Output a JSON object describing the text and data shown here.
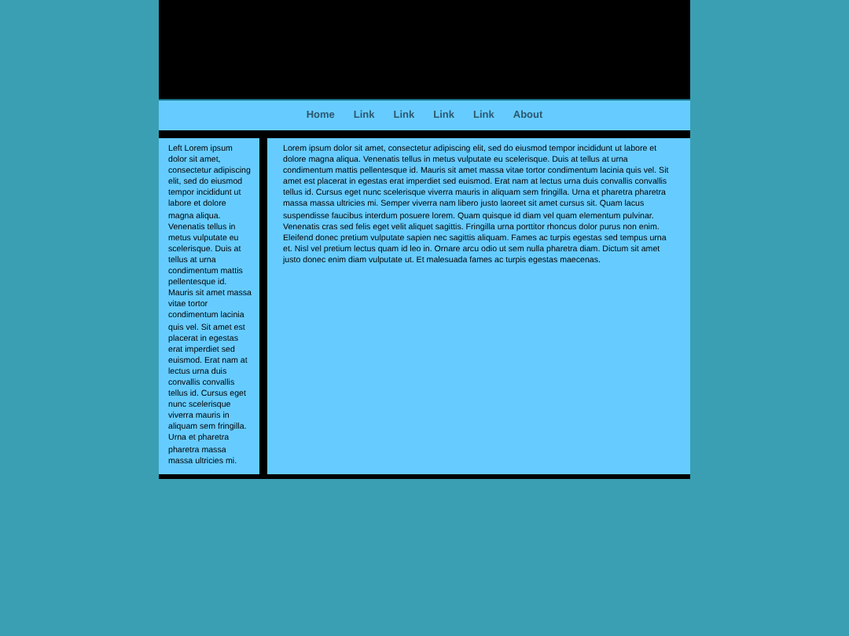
{
  "nav": {
    "links": [
      "Home",
      "Link",
      "Link",
      "Link",
      "Link",
      "About"
    ]
  },
  "sidebar": {
    "text": "Left Lorem ipsum dolor sit amet, consectetur adipiscing elit, sed do eiusmod tempor incididunt ut labore et dolore magna aliqua. Venenatis tellus in metus vulputate eu scelerisque. Duis at tellus at urna condimentum mattis pellentesque id. Mauris sit amet massa vitae tortor condimentum lacinia quis vel. Sit amet est placerat in egestas erat imperdiet sed euismod. Erat nam at lectus urna duis convallis convallis tellus id. Cursus eget nunc scelerisque viverra mauris in aliquam sem fringilla. Urna et pharetra pharetra massa massa ultricies mi."
  },
  "main": {
    "text": "Lorem ipsum dolor sit amet, consectetur adipiscing elit, sed do eiusmod tempor incididunt ut labore et dolore magna aliqua. Venenatis tellus in metus vulputate eu scelerisque. Duis at tellus at urna condimentum mattis pellentesque id. Mauris sit amet massa vitae tortor condimentum lacinia quis vel. Sit amet est placerat in egestas erat imperdiet sed euismod. Erat nam at lectus urna duis convallis convallis tellus id. Cursus eget nunc scelerisque viverra mauris in aliquam sem fringilla. Urna et pharetra pharetra massa massa ultricies mi. Semper viverra nam libero justo laoreet sit amet cursus sit. Quam lacus suspendisse faucibus interdum posuere lorem. Quam quisque id diam vel quam elementum pulvinar. Venenatis cras sed felis eget velit aliquet sagittis. Fringilla urna porttitor rhoncus dolor purus non enim. Eleifend donec pretium vulputate sapien nec sagittis aliquam. Fames ac turpis egestas sed tempus urna et. Nisl vel pretium lectus quam id leo in. Ornare arcu odio ut sem nulla pharetra diam. Dictum sit amet justo donec enim diam vulputate ut. Et malesuada fames ac turpis egestas maecenas."
  }
}
